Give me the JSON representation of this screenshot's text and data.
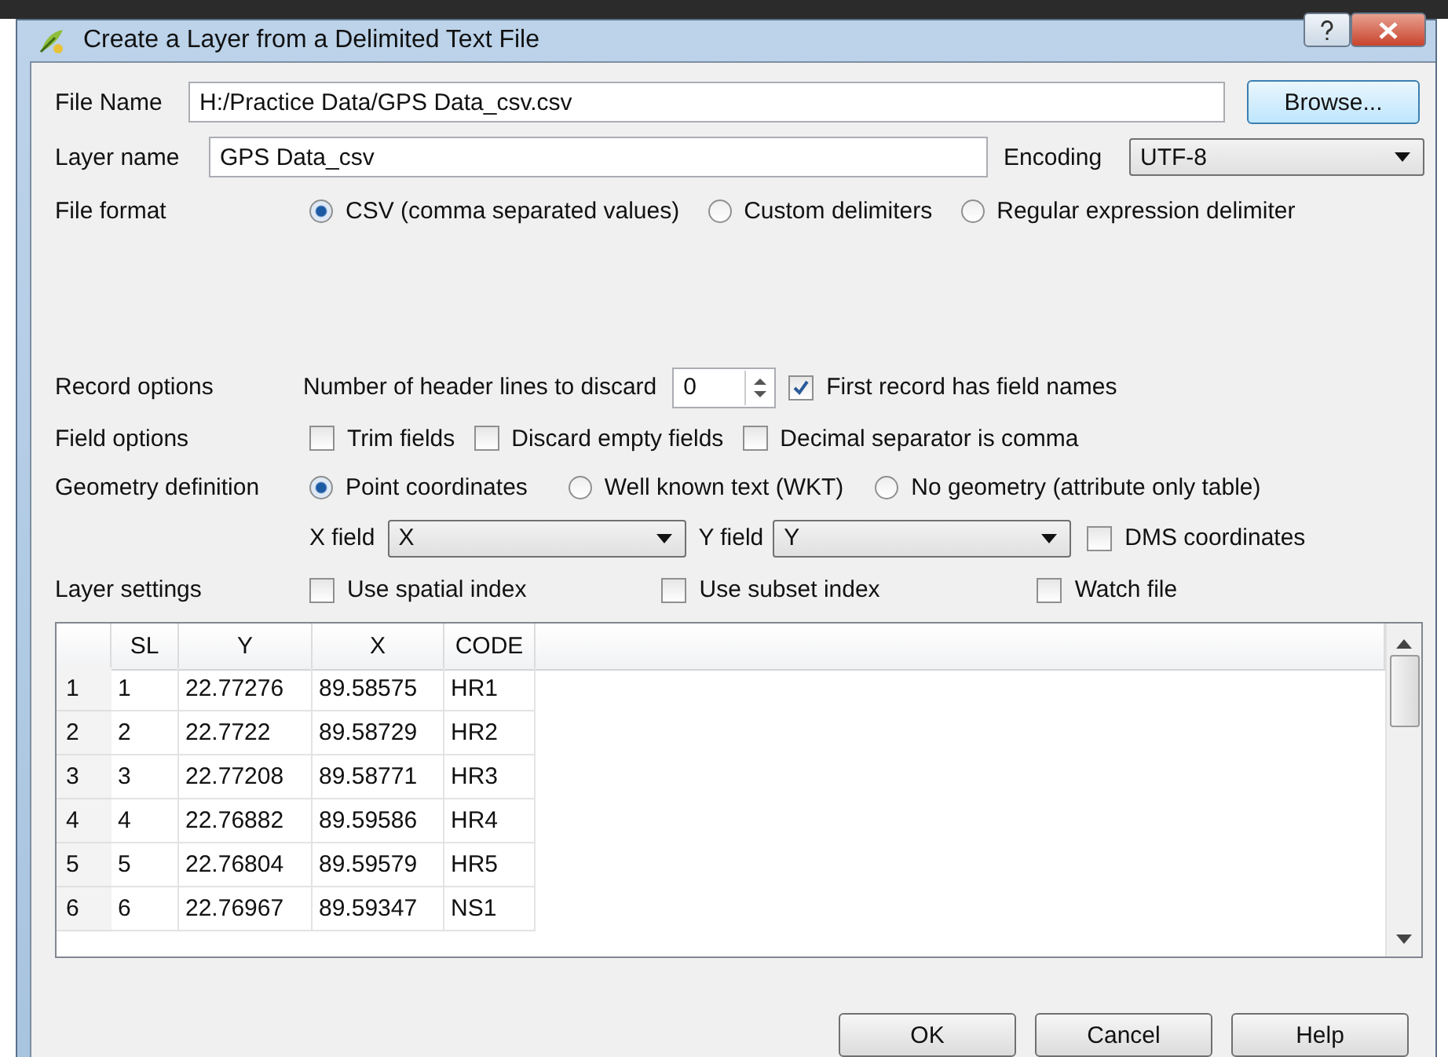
{
  "window": {
    "title": "Create a Layer from a Delimited Text File"
  },
  "file_name": {
    "label": "File Name",
    "value": "H:/Practice Data/GPS Data_csv.csv"
  },
  "browse_button": "Browse...",
  "layer_name": {
    "label": "Layer name",
    "value": "GPS Data_csv"
  },
  "encoding": {
    "label": "Encoding",
    "value": "UTF-8"
  },
  "file_format": {
    "label": "File format",
    "options": [
      {
        "label": "CSV (comma separated values)",
        "selected": true
      },
      {
        "label": "Custom delimiters",
        "selected": false
      },
      {
        "label": "Regular expression delimiter",
        "selected": false
      }
    ]
  },
  "record_options": {
    "label": "Record options",
    "header_lines_label": "Number of header lines to discard",
    "header_lines_value": "0",
    "first_record": {
      "label": "First record has field names",
      "checked": true
    }
  },
  "field_options": {
    "label": "Field options",
    "options": [
      {
        "label": "Trim fields",
        "checked": false
      },
      {
        "label": "Discard empty fields",
        "checked": false
      },
      {
        "label": "Decimal separator is comma",
        "checked": false
      }
    ]
  },
  "geometry": {
    "label": "Geometry definition",
    "options": [
      {
        "label": "Point coordinates",
        "selected": true
      },
      {
        "label": "Well known text (WKT)",
        "selected": false
      },
      {
        "label": "No geometry (attribute only table)",
        "selected": false
      }
    ]
  },
  "x_field": {
    "label": "X field",
    "value": "X"
  },
  "y_field": {
    "label": "Y field",
    "value": "Y"
  },
  "dms": {
    "label": "DMS coordinates",
    "checked": false
  },
  "layer_settings": {
    "label": "Layer settings",
    "options": [
      {
        "label": "Use spatial index",
        "checked": false
      },
      {
        "label": "Use subset index",
        "checked": false
      },
      {
        "label": "Watch file",
        "checked": false
      }
    ]
  },
  "table": {
    "columns": [
      "SL",
      "Y",
      "X",
      "CODE"
    ],
    "rows": [
      {
        "header": "1",
        "cells": [
          "1",
          "22.77276",
          "89.58575",
          "HR1"
        ]
      },
      {
        "header": "2",
        "cells": [
          "2",
          "22.7722",
          "89.58729",
          "HR2"
        ]
      },
      {
        "header": "3",
        "cells": [
          "3",
          "22.77208",
          "89.58771",
          "HR3"
        ]
      },
      {
        "header": "4",
        "cells": [
          "4",
          "22.76882",
          "89.59586",
          "HR4"
        ]
      },
      {
        "header": "5",
        "cells": [
          "5",
          "22.76804",
          "89.59579",
          "HR5"
        ]
      },
      {
        "header": "6",
        "cells": [
          "6",
          "22.76967",
          "89.59347",
          "NS1"
        ]
      }
    ]
  },
  "buttons": [
    "OK",
    "Cancel",
    "Help"
  ]
}
